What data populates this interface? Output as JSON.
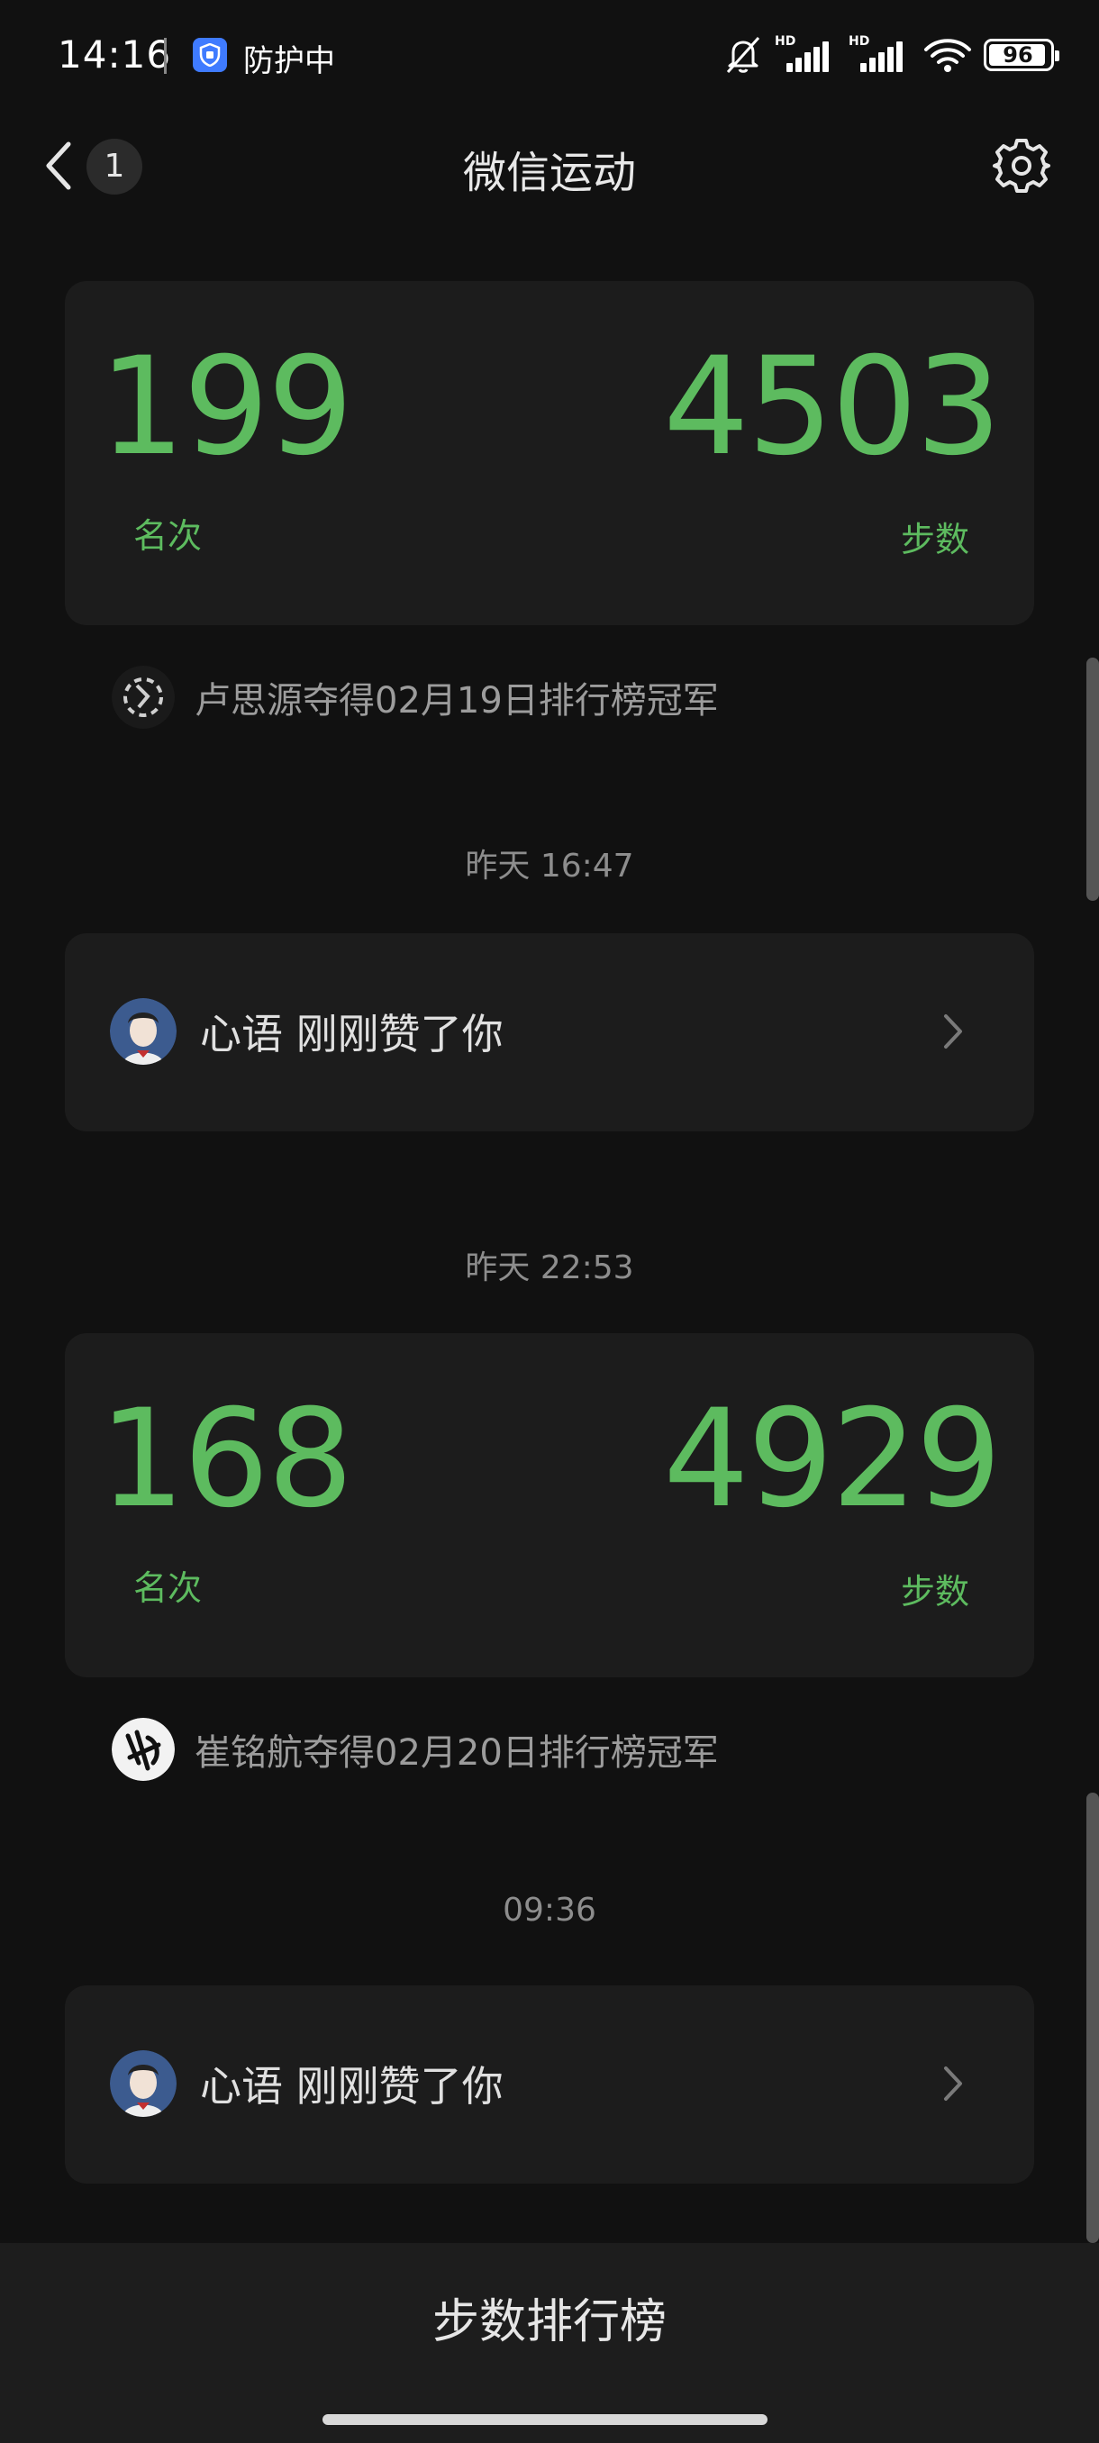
{
  "status_bar": {
    "time": "14:16",
    "protect_label": "防护中",
    "battery": "96",
    "icons": [
      "mute-bell-icon",
      "hd-signal-icon",
      "hd-signal-icon",
      "wifi-icon",
      "battery-icon"
    ]
  },
  "header": {
    "title": "微信运动",
    "back_badge": "1",
    "settings_icon": "gear-icon"
  },
  "feed": [
    {
      "type": "rank",
      "rank": "199",
      "rank_label": "名次",
      "steps": "4503",
      "steps_label": "步数",
      "champion_text": "卢思源夺得02月19日排行榜冠军"
    },
    {
      "type": "time",
      "text": "昨天 16:47"
    },
    {
      "type": "like",
      "text": "心语 刚刚赞了你"
    },
    {
      "type": "time",
      "text": "昨天 22:53"
    },
    {
      "type": "rank",
      "rank": "168",
      "rank_label": "名次",
      "steps": "4929",
      "steps_label": "步数",
      "champion_text": "崔铭航夺得02月20日排行榜冠军"
    },
    {
      "type": "time",
      "text": "09:36"
    },
    {
      "type": "like",
      "text": "心语 刚刚赞了你"
    }
  ],
  "bottom": {
    "ranking_label": "步数排行榜"
  },
  "colors": {
    "background": "#111111",
    "card": "#1c1c1c",
    "accent_green": "#5dbb5f"
  }
}
